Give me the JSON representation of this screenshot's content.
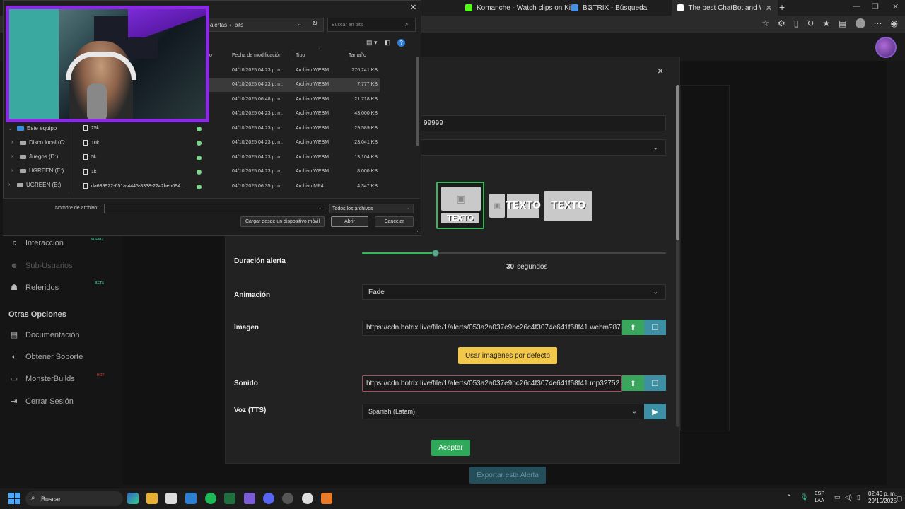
{
  "browser": {
    "tabs": [
      {
        "title": "Komanche - Watch clips on Kick",
        "color": "#53fc18"
      },
      {
        "title": "BOTRIX - Búsqueda",
        "color": "#4a90e2"
      },
      {
        "title": "The best ChatBot and Widgets fo",
        "color": "#ffffff"
      }
    ],
    "new_tab": "+"
  },
  "sidebar": {
    "items": [
      {
        "label": "Interacción",
        "icon": "music-icon",
        "badge": "NUEVO"
      },
      {
        "label": "Sub-Usuarios",
        "icon": "users-icon",
        "badge": ""
      },
      {
        "label": "Referidos",
        "icon": "referral-icon",
        "badge": "BETA"
      }
    ],
    "section": "Otras Opciones",
    "other": [
      {
        "label": "Documentación",
        "icon": "document-icon",
        "badge": ""
      },
      {
        "label": "Obtener Soporte",
        "icon": "support-icon",
        "badge": ""
      },
      {
        "label": "MonsterBuilds",
        "icon": "monitor-icon",
        "badge": "HOT"
      },
      {
        "label": "Cerrar Sesión",
        "icon": "logout-icon",
        "badge": ""
      }
    ]
  },
  "modal": {
    "close": "×",
    "amount_value": "99999",
    "layout_text": "TEXTO",
    "duration_label": "Duración alerta",
    "duration_value": "30",
    "duration_unit": "segundos",
    "duration_fraction": 0.24,
    "animation_label": "Animación",
    "animation_value": "Fade",
    "image_label": "Imagen",
    "image_url": "https://cdn.botrix.live/file/1/alerts/053a2a037e9bc26c4f3074e641f68f41.webm?87",
    "default_images_button": "Usar imagenes por defecto",
    "sound_label": "Sonido",
    "sound_url": "https://cdn.botrix.live/file/1/alerts/053a2a037e9bc26c4f3074e641f68f41.mp3?752",
    "tts_label": "Voz (TTS)",
    "tts_value": "Spanish (Latam)",
    "accept_button": "Aceptar"
  },
  "export_button": "Exportar esta Alerta",
  "file_dialog": {
    "path": [
      "alertas",
      "bits"
    ],
    "search_placeholder": "Buscar en bits",
    "columns": [
      "o",
      "Fecha de modificación",
      "Tipo",
      "Tamaño"
    ],
    "tree": [
      {
        "label": "Este equipo",
        "expanded": true
      },
      {
        "label": "Disco local (C:",
        "expanded": false
      },
      {
        "label": "Juegos (D:)",
        "expanded": false
      },
      {
        "label": "UGREEN (E:)",
        "expanded": false
      },
      {
        "label": "UGREEN (E:)",
        "expanded": false
      }
    ],
    "files": [
      {
        "name": "",
        "date": "04/10/2025 04:23 p. m.",
        "type": "Archivo WEBM",
        "size": "276,241 KB"
      },
      {
        "name": "",
        "date": "04/10/2025 04:23 p. m.",
        "type": "Archivo WEBM",
        "size": "7,777 KB"
      },
      {
        "name": "",
        "date": "04/10/2025 06:48 p. m.",
        "type": "Archivo WEBM",
        "size": "21,718 KB"
      },
      {
        "name": "",
        "date": "04/10/2025 04:23 p. m.",
        "type": "Archivo WEBM",
        "size": "43,000 KB"
      },
      {
        "name": "25k",
        "date": "04/10/2025 04:23 p. m.",
        "type": "Archivo WEBM",
        "size": "29,589 KB"
      },
      {
        "name": "10k",
        "date": "04/10/2025 04:23 p. m.",
        "type": "Archivo WEBM",
        "size": "23,041 KB"
      },
      {
        "name": "5k",
        "date": "04/10/2025 04:23 p. m.",
        "type": "Archivo WEBM",
        "size": "13,104 KB"
      },
      {
        "name": "1k",
        "date": "04/10/2025 04:23 p. m.",
        "type": "Archivo WEBM",
        "size": "8,000 KB"
      },
      {
        "name": "da639922-651a-4445-8338-2242beb094...",
        "date": "04/10/2025 06:35 p. m.",
        "type": "Archivo MP4",
        "size": "4,347 KB"
      }
    ],
    "filename_label": "Nombre de archivo:",
    "filetype": "Todos los archivos",
    "mobile_button": "Cargar desde un dispositivo móvil",
    "open_button": "Abrir",
    "cancel_button": "Cancelar"
  },
  "taskbar": {
    "search": "Buscar",
    "lang_top": "ESP",
    "lang_bottom": "LAA",
    "time": "02:46 p. m.",
    "date": "29/10/2025"
  }
}
